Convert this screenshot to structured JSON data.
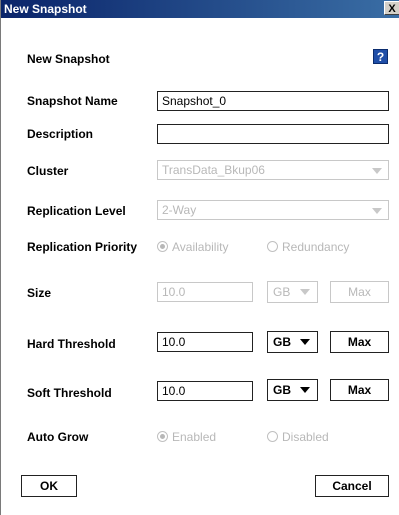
{
  "window": {
    "title": "New Snapshot",
    "close_label": "X"
  },
  "header": {
    "title": "New Snapshot",
    "help_label": "?"
  },
  "fields": {
    "snapshot_name": {
      "label": "Snapshot Name",
      "value": "Snapshot_0"
    },
    "description": {
      "label": "Description",
      "value": ""
    },
    "cluster": {
      "label": "Cluster",
      "value": "TransData_Bkup06"
    },
    "replication_level": {
      "label": "Replication Level",
      "value": "2-Way"
    },
    "replication_priority": {
      "label": "Replication Priority",
      "options": [
        "Availability",
        "Redundancy"
      ],
      "selected": "Availability"
    },
    "size": {
      "label": "Size",
      "value": "10.0",
      "unit": "GB",
      "max_label": "Max"
    },
    "hard_threshold": {
      "label": "Hard Threshold",
      "value": "10.0",
      "unit": "GB",
      "max_label": "Max"
    },
    "soft_threshold": {
      "label": "Soft Threshold",
      "value": "10.0",
      "unit": "GB",
      "max_label": "Max"
    },
    "auto_grow": {
      "label": "Auto Grow",
      "options": [
        "Enabled",
        "Disabled"
      ],
      "selected": "Enabled"
    }
  },
  "buttons": {
    "ok": "OK",
    "cancel": "Cancel"
  }
}
